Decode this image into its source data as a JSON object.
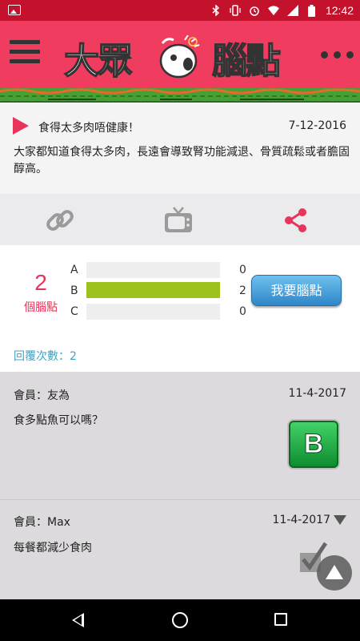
{
  "status_bar": {
    "time": "12:42",
    "icons": [
      "image-icon",
      "bluetooth-icon",
      "vibrate-icon",
      "alarm-icon",
      "wifi-icon",
      "signal-icon",
      "battery-icon"
    ]
  },
  "app_bar": {
    "logo_left": "大眾",
    "logo_right": "腦點",
    "colors": {
      "bar": "#f03c5f",
      "status": "#c4122d"
    }
  },
  "post": {
    "title": "食得太多肉唔健康！",
    "date": "7-12-2016",
    "body": "大家都知道食得太多肉，長遠會導致腎功能減退、骨質疏鬆或者膽固醇高。"
  },
  "actions": {
    "icons": [
      "link-icon",
      "tv-icon",
      "share-icon"
    ],
    "share_color": "#e8335a"
  },
  "poll": {
    "count": "2",
    "unit": "個腦點",
    "options": [
      {
        "label": "A",
        "votes": "0",
        "fraction": 0
      },
      {
        "label": "B",
        "votes": "2",
        "fraction": 1
      },
      {
        "label": "C",
        "votes": "0",
        "fraction": 0
      }
    ],
    "vote_button": "我要腦點",
    "reply_count": "回覆次數：2"
  },
  "comments": [
    {
      "member": "會員：友為",
      "date": "11-4-2017",
      "text": "食多點魚可以嗎？",
      "badge": "B"
    },
    {
      "member": "會員：Max",
      "date": "11-4-2017",
      "text": "每餐都減少食肉"
    }
  ]
}
